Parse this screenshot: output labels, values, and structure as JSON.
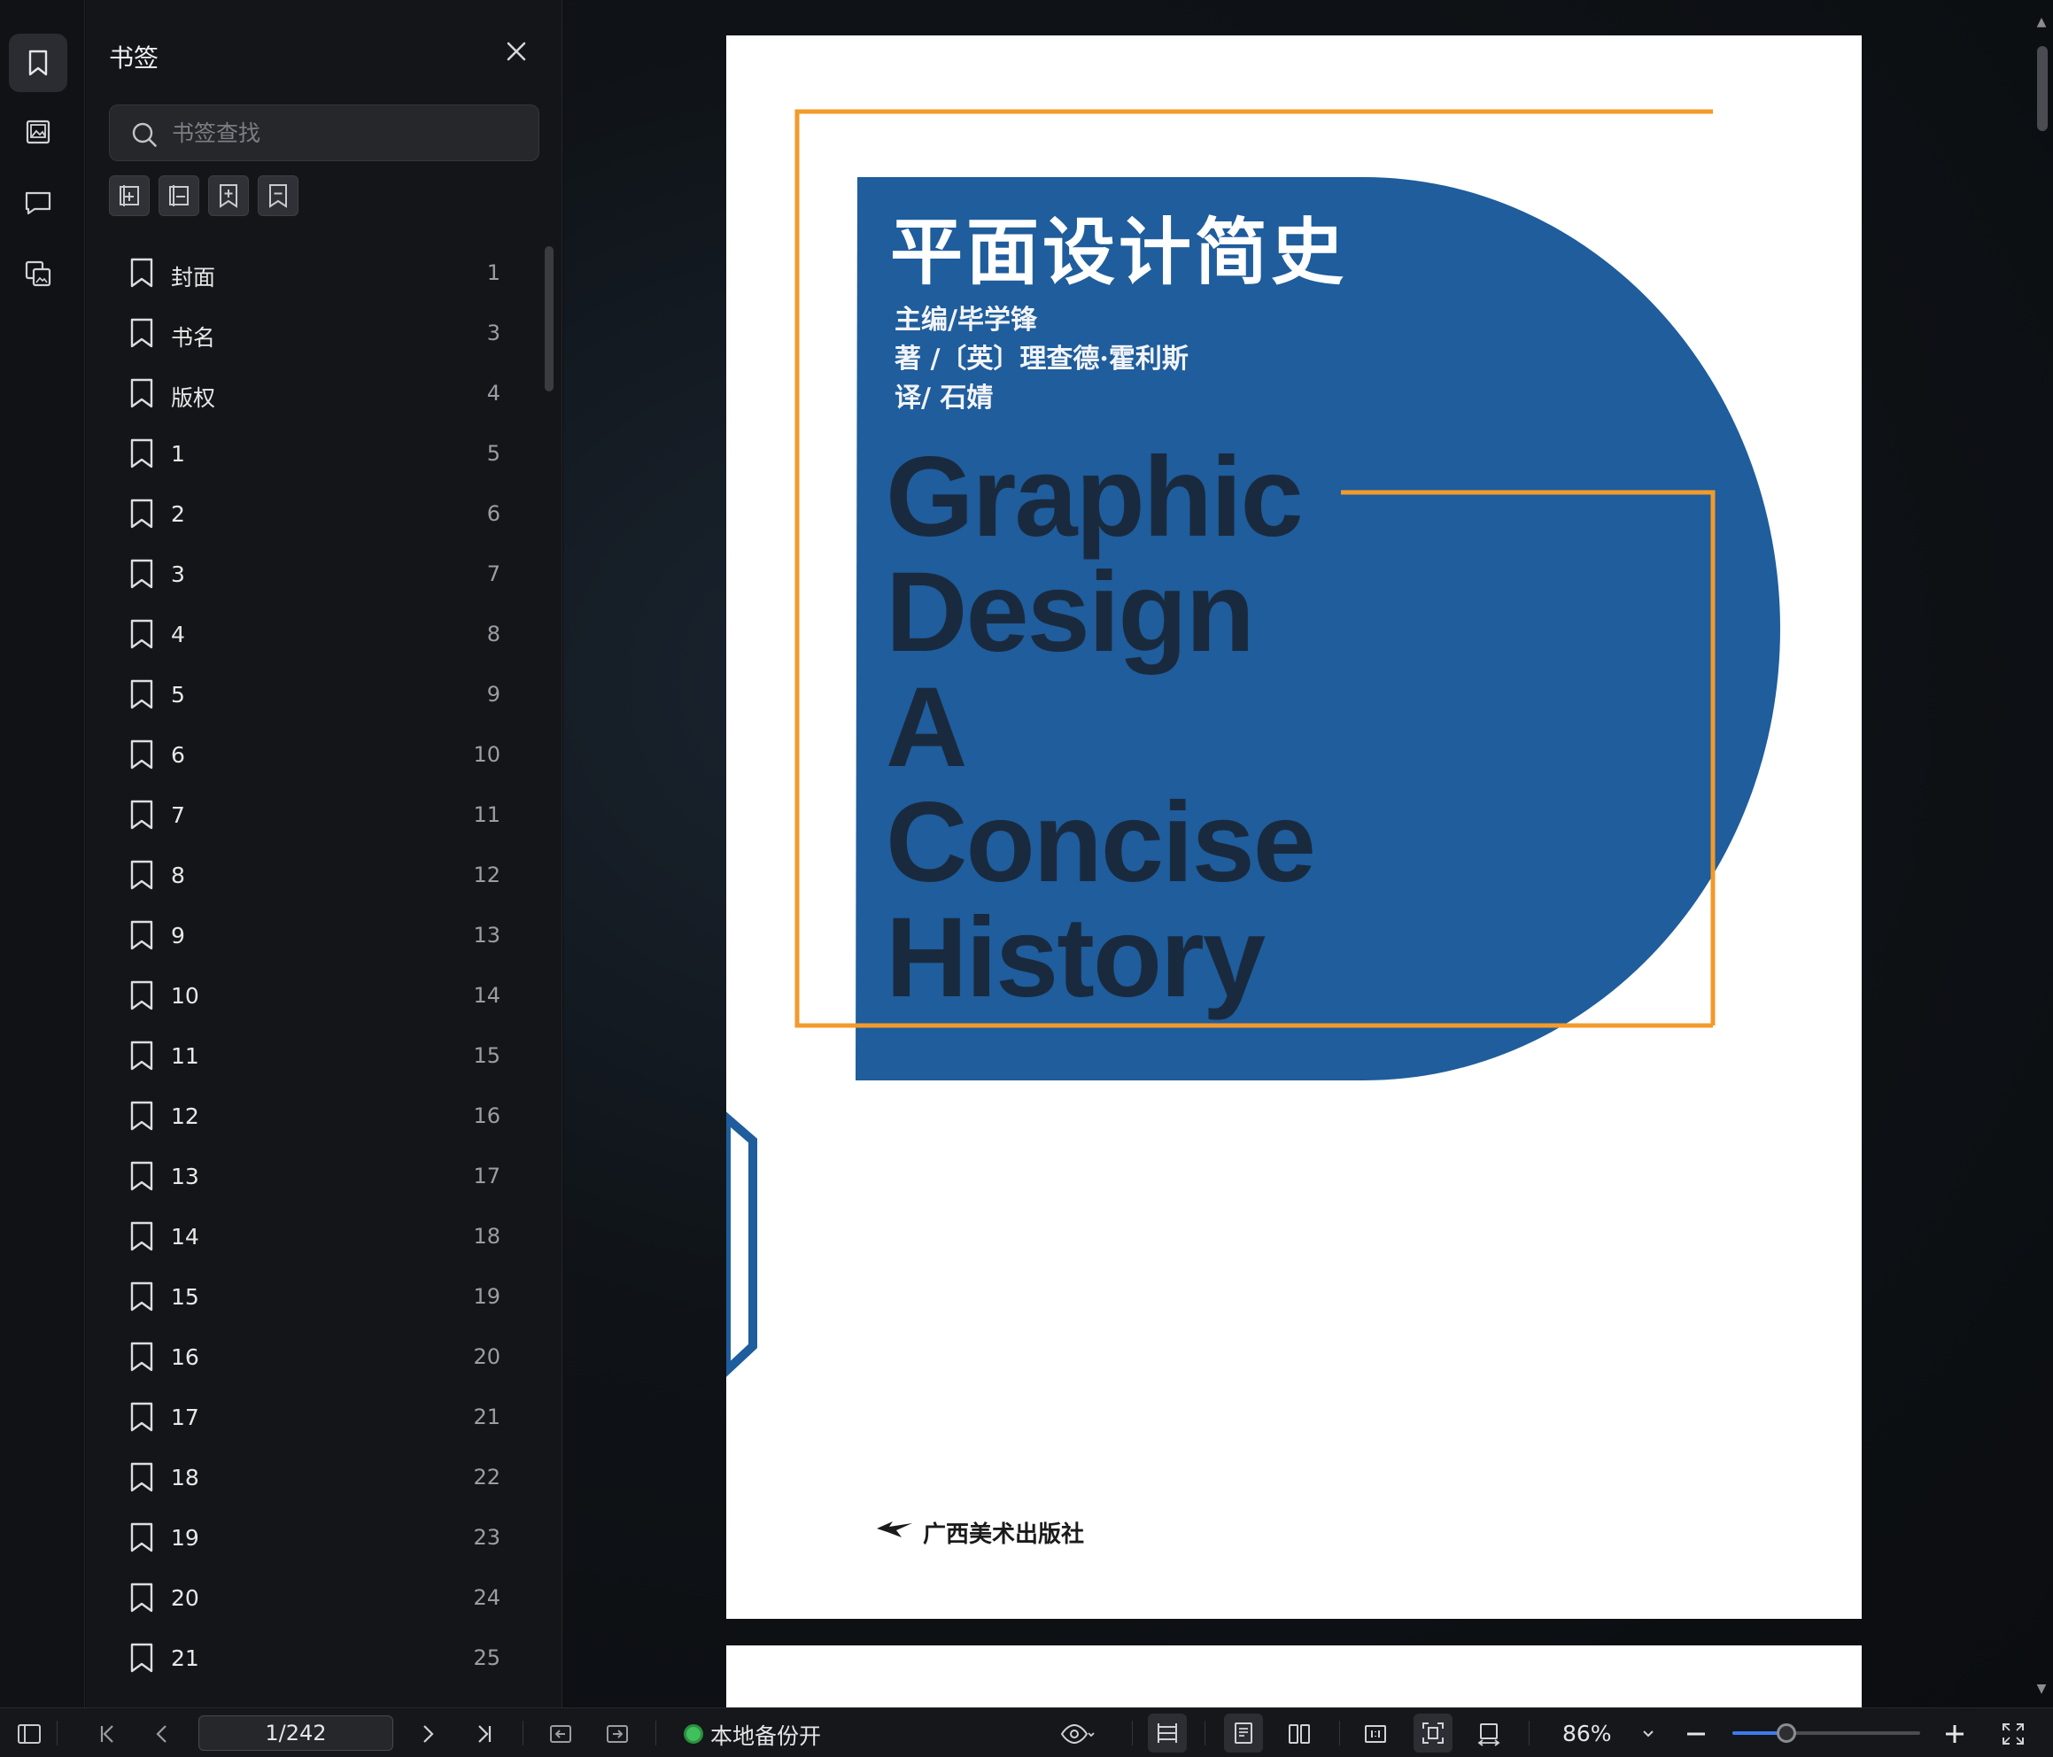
{
  "panel": {
    "title": "书签",
    "search_placeholder": "书签查找"
  },
  "bookmarks": [
    {
      "label": "封面",
      "page": "1"
    },
    {
      "label": "书名",
      "page": "3"
    },
    {
      "label": "版权",
      "page": "4"
    },
    {
      "label": "1",
      "page": "5"
    },
    {
      "label": "2",
      "page": "6"
    },
    {
      "label": "3",
      "page": "7"
    },
    {
      "label": "4",
      "page": "8"
    },
    {
      "label": "5",
      "page": "9"
    },
    {
      "label": "6",
      "page": "10"
    },
    {
      "label": "7",
      "page": "11"
    },
    {
      "label": "8",
      "page": "12"
    },
    {
      "label": "9",
      "page": "13"
    },
    {
      "label": "10",
      "page": "14"
    },
    {
      "label": "11",
      "page": "15"
    },
    {
      "label": "12",
      "page": "16"
    },
    {
      "label": "13",
      "page": "17"
    },
    {
      "label": "14",
      "page": "18"
    },
    {
      "label": "15",
      "page": "19"
    },
    {
      "label": "16",
      "page": "20"
    },
    {
      "label": "17",
      "page": "21"
    },
    {
      "label": "18",
      "page": "22"
    },
    {
      "label": "19",
      "page": "23"
    },
    {
      "label": "20",
      "page": "24"
    },
    {
      "label": "21",
      "page": "25"
    }
  ],
  "cover": {
    "title_zh": "平面设计简史",
    "credit_editor": "主编/毕学锋",
    "credit_author": "著 /〔英〕理查德·霍利斯",
    "credit_translator": "译/ 石婧",
    "title_en_lines": [
      "Graphic",
      "Design",
      "A",
      "Concise",
      "History"
    ],
    "publisher": "广西美术出版社"
  },
  "status": {
    "page_value": "1/242",
    "backup_label": "本地备份开",
    "zoom_label": "86%",
    "zoom_fraction": 0.29
  },
  "colors": {
    "cover_blue": "#1f5d9c",
    "cover_orange": "#f39a2b",
    "accent": "#3c7bf0",
    "backup_green": "#3fc05a"
  }
}
